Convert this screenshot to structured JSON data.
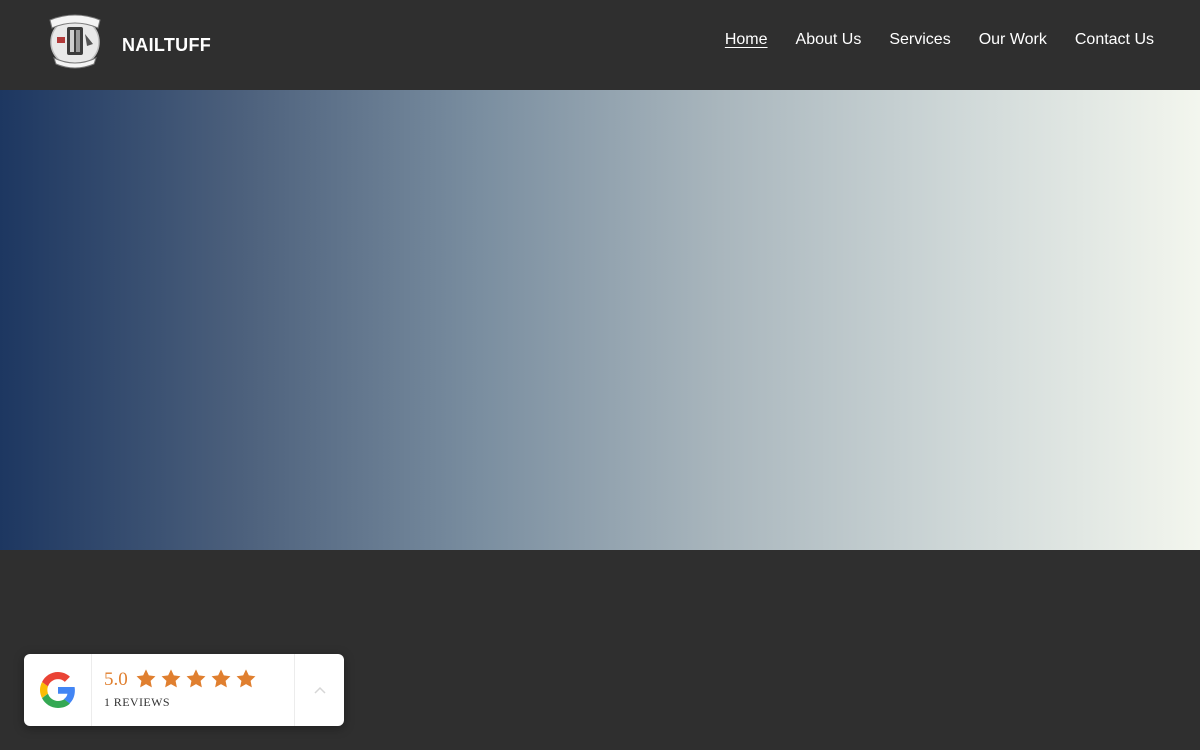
{
  "header": {
    "brand": "NAILTUFF",
    "logo_icon": "nailtuff-crest-icon",
    "nav": [
      {
        "label": "Home",
        "active": true
      },
      {
        "label": "About Us",
        "active": false
      },
      {
        "label": "Services",
        "active": false
      },
      {
        "label": "Our Work",
        "active": false
      },
      {
        "label": "Contact Us",
        "active": false
      }
    ]
  },
  "hero": {
    "gradient_start": "#1d3761",
    "gradient_end": "#f3f6ee"
  },
  "review_widget": {
    "provider_icon": "google-g-icon",
    "score": "5.0",
    "stars": 5,
    "star_color": "#e07f2f",
    "reviews_label": "1 REVIEWS",
    "toggle_icon": "chevron-up-icon"
  },
  "colors": {
    "background": "#2f2f2f",
    "text": "#ffffff"
  }
}
